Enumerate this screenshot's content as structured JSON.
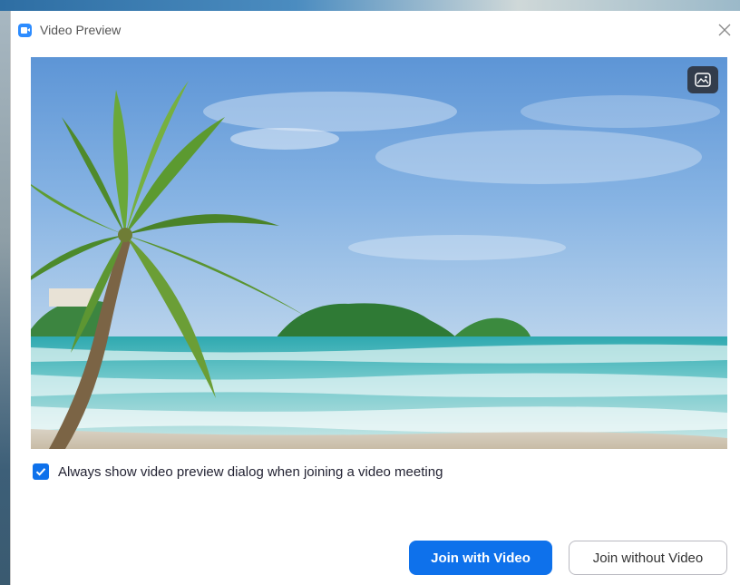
{
  "dialog": {
    "title": "Video Preview",
    "app_icon": "zoom-video-icon",
    "close_icon": "close-icon"
  },
  "preview": {
    "background_toggle_icon": "virtual-background-icon"
  },
  "checkbox": {
    "checked": true,
    "label": "Always show video preview dialog when joining a video meeting"
  },
  "buttons": {
    "join_with_video": "Join with Video",
    "join_without_video": "Join without Video"
  },
  "colors": {
    "accent": "#0e71eb",
    "app_icon": "#2d8cff"
  }
}
